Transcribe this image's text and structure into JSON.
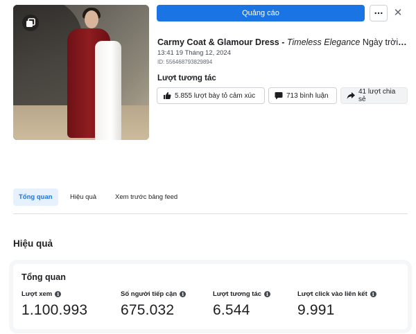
{
  "header": {
    "boost_label": "Quảng cáo",
    "more_label": "···",
    "close_label": "✕"
  },
  "post": {
    "title_bold": "Carmy Coat & Glamour Dress - ",
    "title_italic": "Timeless Elegance",
    "title_rest": " Ngày trời ...",
    "date": "13:41 19 Tháng 12, 2024",
    "id": "ID: 556468793829894"
  },
  "interactions": {
    "label": "Lượt tương tác",
    "reactions": "5.855 lượt bày tỏ cảm xúc",
    "comments": "713 bình luận",
    "shares": "41 lượt chia sẻ"
  },
  "tabs": [
    {
      "label": "Tổng quan",
      "active": true
    },
    {
      "label": "Hiệu quả",
      "active": false
    },
    {
      "label": "Xem trước bảng feed",
      "active": false
    }
  ],
  "section_title": "Hiệu quả",
  "overview_card": {
    "title": "Tổng quan",
    "metrics": [
      {
        "label": "Lượt xem",
        "value": "1.100.993"
      },
      {
        "label": "Số người tiếp cận",
        "value": "675.032"
      },
      {
        "label": "Lượt tương tác",
        "value": "6.544"
      },
      {
        "label": "Lượt click vào liên kết",
        "value": "9.991"
      }
    ]
  },
  "colors": {
    "accent": "#1b74e4",
    "active_tab_bg": "#e7f0fd",
    "coat": "#8f1c20"
  },
  "icons": {
    "album": "album-icon",
    "more": "more-icon",
    "close": "close-icon",
    "reactions": "thumbs-up-icon",
    "comments": "comment-icon",
    "shares": "share-icon",
    "info": "info-icon"
  }
}
